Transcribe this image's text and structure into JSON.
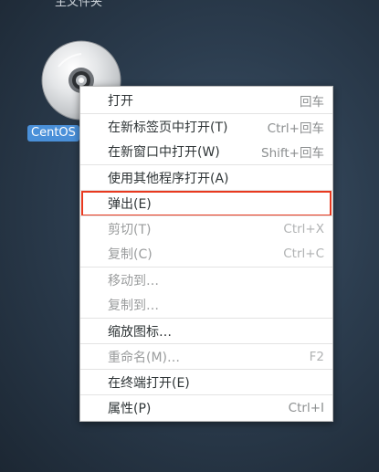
{
  "desktop": {
    "top_label": "主文件夹",
    "disc_label": "CentOS"
  },
  "context_menu": {
    "items": [
      {
        "label": "打开",
        "shortcut": "回车",
        "enabled": true
      },
      {
        "label": "在新标签页中打开(T)",
        "shortcut": "Ctrl+回车",
        "enabled": true
      },
      {
        "label": "在新窗口中打开(W)",
        "shortcut": "Shift+回车",
        "enabled": true
      },
      {
        "label": "使用其他程序打开(A)",
        "shortcut": "",
        "enabled": true
      },
      {
        "label": "弹出(E)",
        "shortcut": "",
        "enabled": true,
        "highlighted": true
      },
      {
        "label": "剪切(T)",
        "shortcut": "Ctrl+X",
        "enabled": false
      },
      {
        "label": "复制(C)",
        "shortcut": "Ctrl+C",
        "enabled": false
      },
      {
        "label": "移动到…",
        "shortcut": "",
        "enabled": false
      },
      {
        "label": "复制到…",
        "shortcut": "",
        "enabled": false
      },
      {
        "label": "缩放图标…",
        "shortcut": "",
        "enabled": true
      },
      {
        "label": "重命名(M)…",
        "shortcut": "F2",
        "enabled": false
      },
      {
        "label": "在终端打开(E)",
        "shortcut": "",
        "enabled": true
      },
      {
        "label": "属性(P)",
        "shortcut": "Ctrl+I",
        "enabled": true
      }
    ]
  },
  "colors": {
    "selection_label": "#4a90d9",
    "highlight_box": "#e8391f"
  }
}
